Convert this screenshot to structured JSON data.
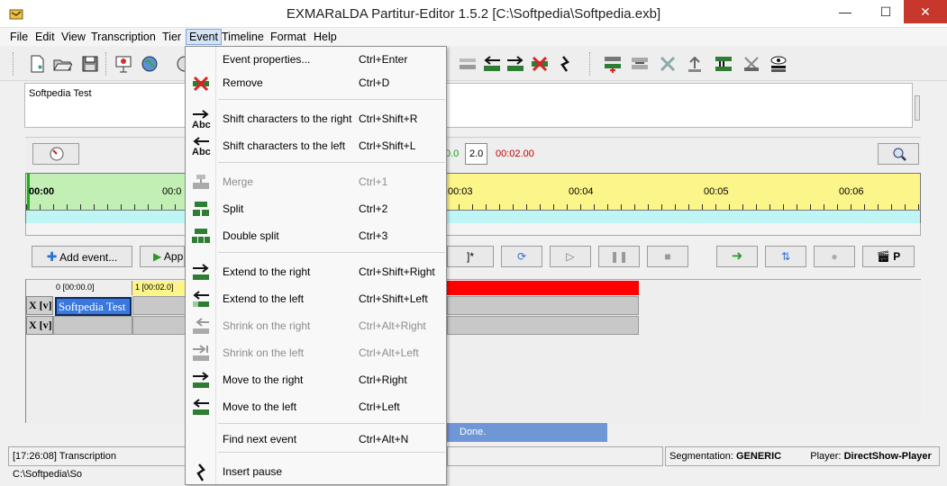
{
  "window": {
    "title": "EXMARaLDA Partitur-Editor 1.5.2 [C:\\Softpedia\\Softpedia.exb]",
    "minimize": "—",
    "maximize": "☐",
    "close": "✕"
  },
  "menubar": [
    "File",
    "Edit",
    "View",
    "Transcription",
    "Tier",
    "Event",
    "Timeline",
    "Format",
    "Help"
  ],
  "text_panel": {
    "text": "Softpedia Test"
  },
  "timeline": {
    "green_time": "0.0",
    "zoom_value": "2.0",
    "red_time": "00:02.00",
    "ticks": [
      "00:00",
      "00:0",
      "00:03",
      "00:04",
      "00:05",
      "00:06"
    ]
  },
  "buttons": {
    "add_event": "Add event...",
    "append": "App",
    "bracket": "]*",
    "p_label": "P"
  },
  "partitur": {
    "col0": "0 [00:00.0]",
    "col1": "1 [00:02.0]",
    "tier_label": "X [v]",
    "event_text": "Softpedia Test"
  },
  "status": {
    "done": "Done.",
    "transcription": "[17:26:08] Transcription C:\\Softpedia\\So",
    "segmentation_label": "Segmentation:",
    "segmentation_value": "GENERIC",
    "player_label": "Player:",
    "player_value": "DirectShow-Player"
  },
  "event_menu": {
    "items": [
      {
        "label": "Event properties...",
        "shortcut": "Ctrl+Enter",
        "icon": "none",
        "disabled": false
      },
      {
        "label": "Remove",
        "shortcut": "Ctrl+D",
        "icon": "remove-icon",
        "disabled": false
      },
      {
        "label": "Shift characters to the right",
        "shortcut": "Ctrl+Shift+R",
        "icon": "shift-right-abc-icon",
        "disabled": false
      },
      {
        "label": "Shift characters to the left",
        "shortcut": "Ctrl+Shift+L",
        "icon": "shift-left-abc-icon",
        "disabled": false
      },
      {
        "label": "Merge",
        "shortcut": "Ctrl+1",
        "icon": "merge-icon",
        "disabled": true
      },
      {
        "label": "Split",
        "shortcut": "Ctrl+2",
        "icon": "split-icon",
        "disabled": false
      },
      {
        "label": "Double split",
        "shortcut": "Ctrl+3",
        "icon": "double-split-icon",
        "disabled": false
      },
      {
        "label": "Extend to the right",
        "shortcut": "Ctrl+Shift+Right",
        "icon": "extend-right-icon",
        "disabled": false
      },
      {
        "label": "Extend to the left",
        "shortcut": "Ctrl+Shift+Left",
        "icon": "extend-left-icon",
        "disabled": false
      },
      {
        "label": "Shrink on the right",
        "shortcut": "Ctrl+Alt+Right",
        "icon": "shrink-right-icon",
        "disabled": true
      },
      {
        "label": "Shrink on the left",
        "shortcut": "Ctrl+Alt+Left",
        "icon": "shrink-left-icon",
        "disabled": true
      },
      {
        "label": "Move to the right",
        "shortcut": "Ctrl+Right",
        "icon": "move-right-icon",
        "disabled": false
      },
      {
        "label": "Move to the left",
        "shortcut": "Ctrl+Left",
        "icon": "move-left-icon",
        "disabled": false
      },
      {
        "label": "Find next event",
        "shortcut": "Ctrl+Alt+N",
        "icon": "none",
        "disabled": false
      },
      {
        "label": "Insert pause",
        "shortcut": "",
        "icon": "pause-icon",
        "disabled": false
      }
    ]
  },
  "colors": {
    "ruler_green": "#c2f0b4",
    "ruler_yellow": "#fcf58a",
    "selection_red": "#ff0000",
    "event_blue": "#3a78e0",
    "done_blue": "#6f97d6"
  }
}
